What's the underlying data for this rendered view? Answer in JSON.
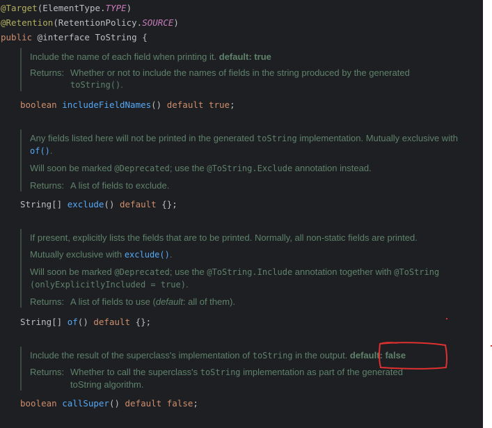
{
  "header": {
    "l1_ann": "@Target",
    "l1_args_a": "(ElementType.",
    "l1_args_b": "TYPE",
    "l1_args_c": ")",
    "l2_ann": "@Retention",
    "l2_args_a": "(RetentionPolicy.",
    "l2_args_b": "SOURCE",
    "l2_args_c": ")",
    "l3_kw": "public",
    "l3_rest": " @interface ToString {"
  },
  "members": [
    {
      "doc_text": "Include the name of each field when printing it.",
      "doc_default": "default: true",
      "returns_label": "Returns:",
      "returns_text_a": "Whether or not to include the names of fields in the string produced by the generated",
      "returns_code": "toString()",
      "returns_text_b": ".",
      "sig_type": "boolean ",
      "sig_name": "includeFieldNames",
      "sig_parens": "() ",
      "sig_default_kw": "default ",
      "sig_value": "true",
      "sig_end": ";"
    },
    {
      "doc_a1": "Any fields listed here will not be printed in the generated ",
      "doc_a_code": "toString",
      "doc_a2": " implementation. Mutually exclusive with ",
      "doc_a_link": "of()",
      "doc_a3": ".",
      "doc_b1": "Will soon be marked ",
      "doc_b_code1": "@Deprecated",
      "doc_b2": "; use the ",
      "doc_b_code2": "@ToString.Exclude",
      "doc_b3": " annotation instead.",
      "returns_label": "Returns:",
      "returns_text": "A list of fields to exclude.",
      "sig_type": "String[] ",
      "sig_name": "exclude",
      "sig_parens": "() ",
      "sig_default_kw": "default ",
      "sig_value": "{}",
      "sig_end": ";"
    },
    {
      "doc_a": "If present, explicitly lists the fields that are to be printed. Normally, all non-static fields are printed.",
      "doc_b1": "Mutually exclusive with ",
      "doc_b_link": "exclude()",
      "doc_b2": ".",
      "doc_c1": "Will soon be marked ",
      "doc_c_code1": "@Deprecated",
      "doc_c2": "; use the ",
      "doc_c_code2": "@ToString.Include",
      "doc_c3": " annotation together with ",
      "doc_c_code3": "@ToString",
      "doc_c_code4": "(onlyExplicitlyIncluded = true)",
      "doc_c4": ".",
      "returns_label": "Returns:",
      "returns_text_a": "A list of fields to use (",
      "returns_em": "default",
      "returns_text_b": ": all of them).",
      "sig_type": "String[] ",
      "sig_name": "of",
      "sig_parens": "() ",
      "sig_default_kw": "default ",
      "sig_value": "{}",
      "sig_end": ";"
    },
    {
      "doc_text_a": "Include the result of the superclass's implementation of ",
      "doc_code": "toString",
      "doc_text_b": " in the output. ",
      "doc_default": "default: false",
      "returns_label": "Returns:",
      "returns_text_a": "Whether to call the superclass's ",
      "returns_code": "toString",
      "returns_text_b": " implementation as part of the generated",
      "returns_text_c": "toString algorithm.",
      "sig_type": "boolean ",
      "sig_name": "callSuper",
      "sig_parens": "() ",
      "sig_default_kw": "default ",
      "sig_value": "false",
      "sig_end": ";"
    }
  ],
  "colors": {
    "background": "#1e1f22",
    "annotation": "#b3ae60",
    "keyword": "#cf8e6d",
    "method": "#56a8f5",
    "doc_text": "#5f826b",
    "highlight": "#e03030"
  }
}
